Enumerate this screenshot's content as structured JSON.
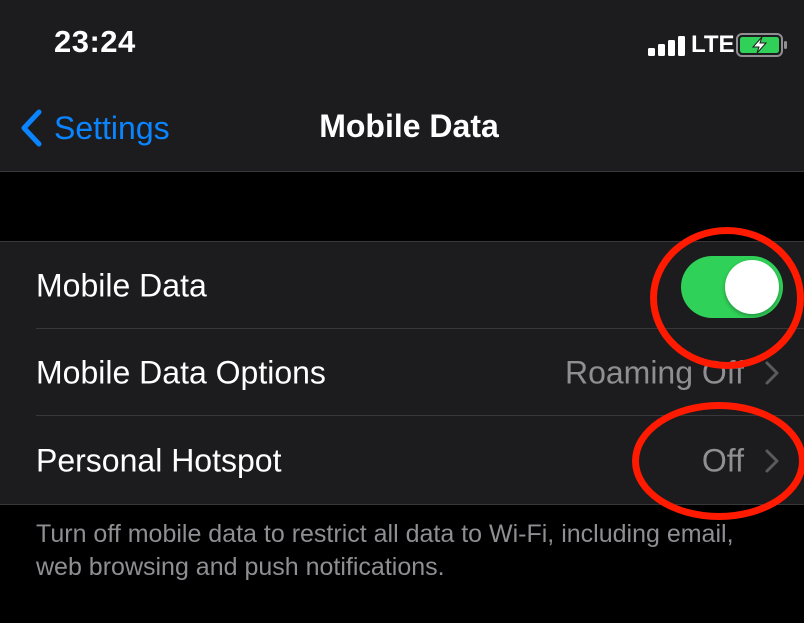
{
  "status_bar": {
    "time": "23:24",
    "network": "LTE",
    "battery_state": "charging",
    "battery_color": "#30d158"
  },
  "nav": {
    "back_label": "Settings",
    "back_icon": "chevron-left-icon",
    "title": "Mobile Data",
    "accent_color": "#0a84ff"
  },
  "settings": {
    "rows": [
      {
        "label": "Mobile Data",
        "control": "toggle",
        "toggle_on": true
      },
      {
        "label": "Mobile Data Options",
        "value": "Roaming Off",
        "control": "disclosure"
      },
      {
        "label": "Personal Hotspot",
        "value": "Off",
        "control": "disclosure"
      }
    ],
    "footer": "Turn off mobile data to restrict all data to Wi-Fi, including email, web browsing and push notifications."
  },
  "annotations": {
    "color": "#ff1a00",
    "targets": [
      "mobile-data-toggle",
      "personal-hotspot-value"
    ]
  }
}
